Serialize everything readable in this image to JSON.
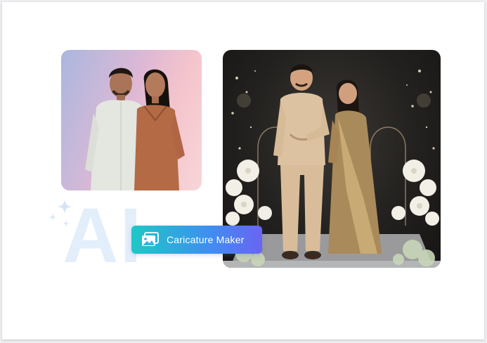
{
  "badge": {
    "label": "Caricature Maker",
    "icon": "image-gallery-icon"
  },
  "decor": {
    "watermark_text": "AI"
  },
  "colors": {
    "badge_gradient_start": "#1dc9c6",
    "badge_gradient_end": "#6a64f2",
    "watermark": "#e3eefb",
    "background": "#ffffff"
  }
}
